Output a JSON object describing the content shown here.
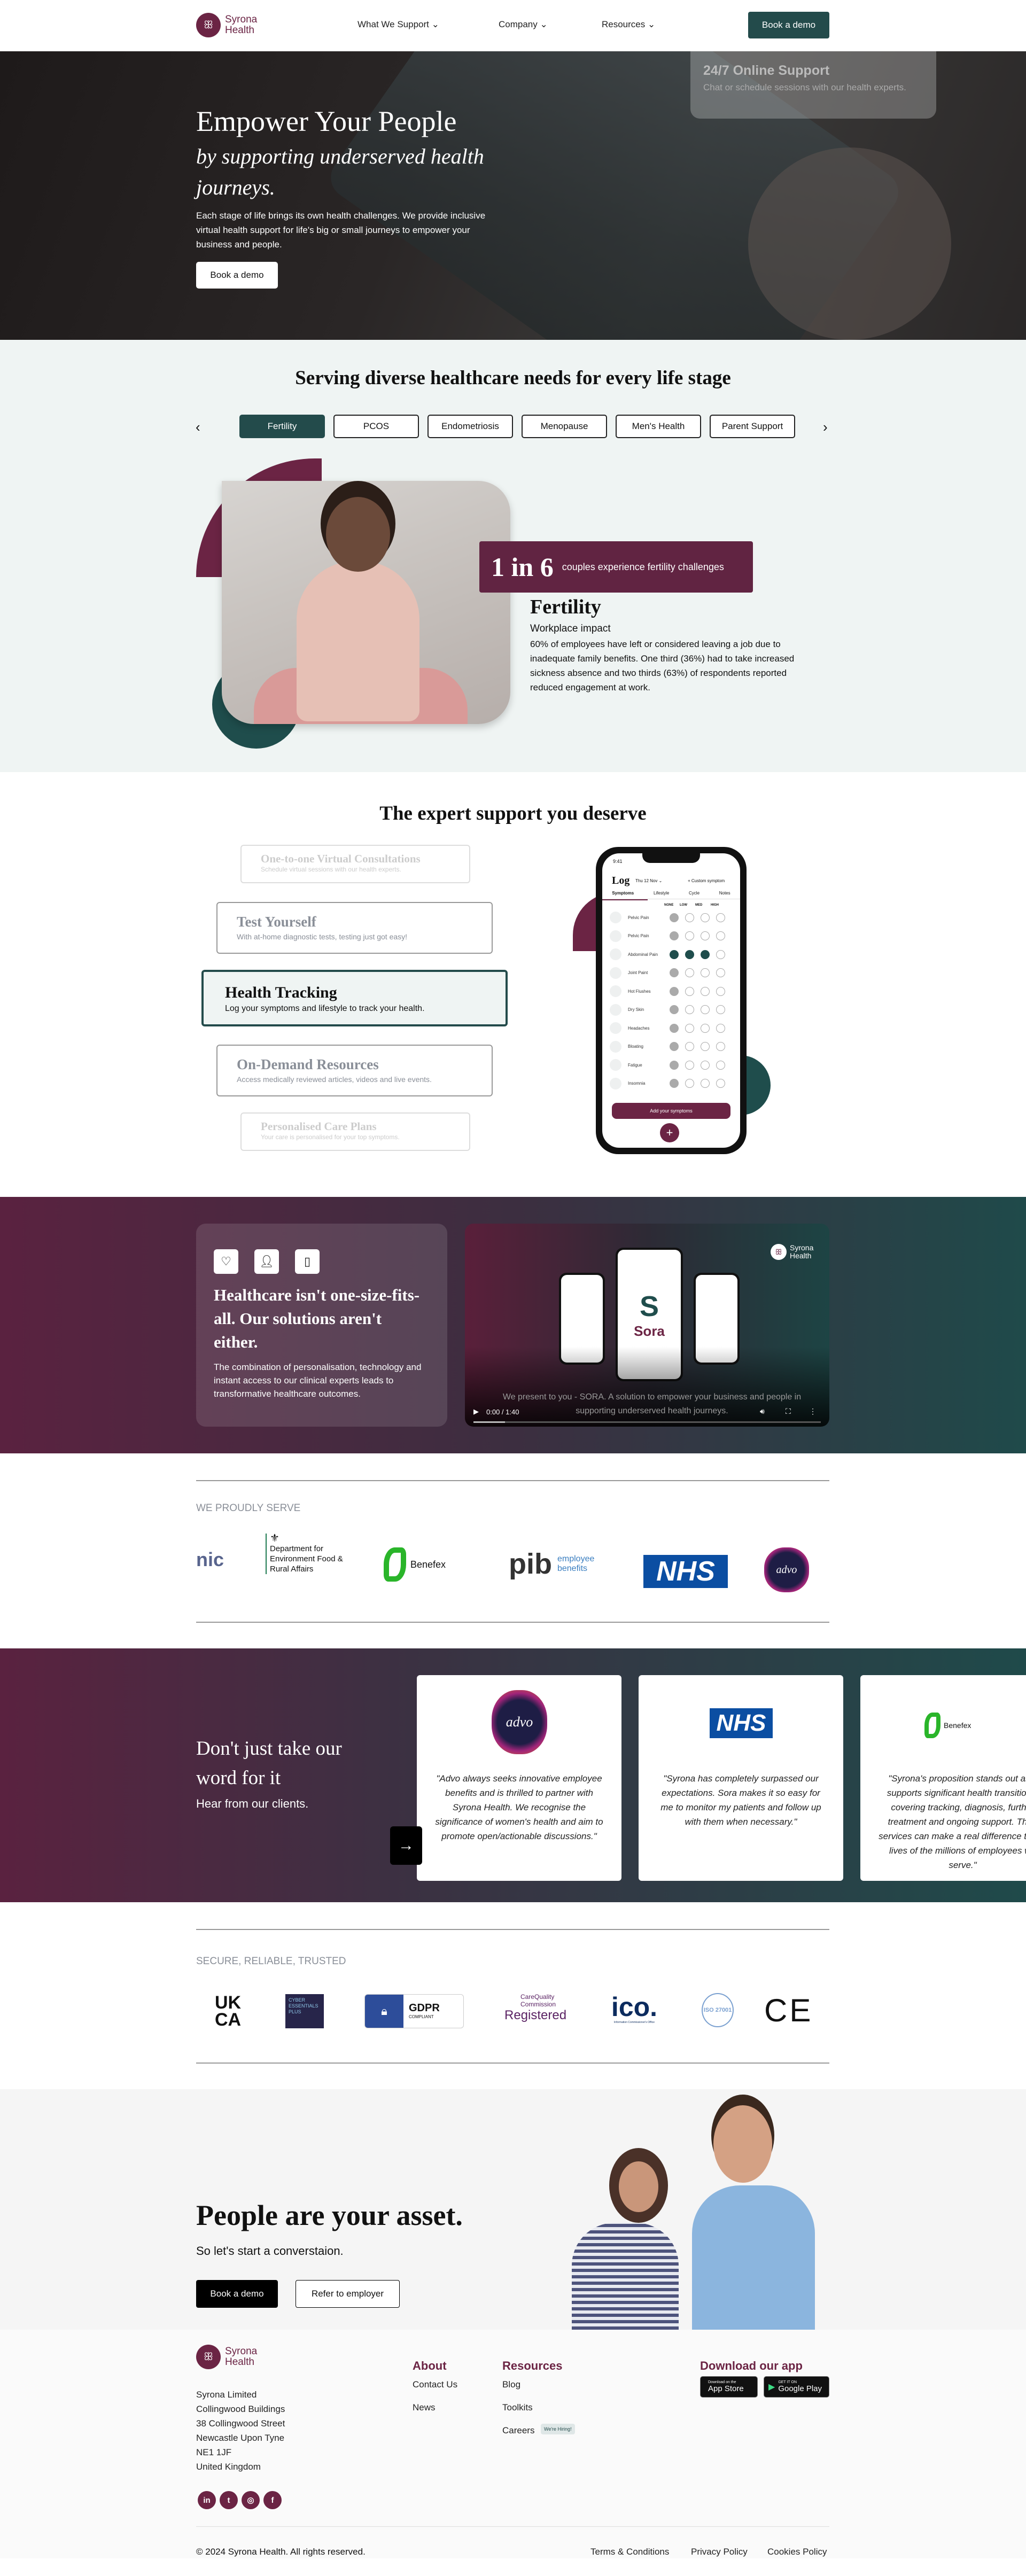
{
  "nav": {
    "brand_line1": "Syrona",
    "brand_line2": "Health",
    "items": [
      {
        "label": "What We Support"
      },
      {
        "label": "Company"
      },
      {
        "label": "Resources"
      }
    ],
    "cta": "Book a demo"
  },
  "hero": {
    "title": "Empower Your People",
    "subtitle": "by supporting underserved health journeys.",
    "body": "Each stage of life brings its own health challenges. We provide inclusive virtual health support for life's big or small journeys to empower your business and people.",
    "cta": "Book a demo",
    "overlay_title": "24/7 Online Support",
    "overlay_text": "Chat or schedule sessions with our health experts."
  },
  "life_stage": {
    "title": "Serving diverse healthcare needs for every life stage",
    "tabs": [
      "Fertility",
      "PCOS",
      "Endometriosis",
      "Menopause",
      "Men's Health",
      "Parent Support"
    ],
    "active_tab": "Fertility",
    "stat_value": "1 in 6",
    "stat_text": "couples experience fertility challenges",
    "heading": "Fertility",
    "subheading": "Workplace impact",
    "body": "60% of employees have left or considered leaving a job due to inadequate family benefits. One third (36%) had to take increased sickness absence and two thirds (63%) of respondents reported reduced engagement at work."
  },
  "expert": {
    "title": "The expert support you deserve",
    "cards": [
      {
        "title": "One-to-one Virtual Consultations",
        "text": "Schedule virtual sessions with our health experts."
      },
      {
        "title": "Test Yourself",
        "text": "With at-home diagnostic tests, testing just got easy!"
      },
      {
        "title": "Health Tracking",
        "text": "Log your symptoms and lifestyle to track your health."
      },
      {
        "title": "On-Demand Resources",
        "text": "Access medically reviewed articles, videos and live events."
      },
      {
        "title": "Personalised Care Plans",
        "text": "Your care is personalised for your top symptoms."
      }
    ],
    "active_card": "Health Tracking",
    "phone": {
      "time": "9:41",
      "title": "Log",
      "date": "Thu 12 Nov",
      "custom": "+ Custom symptom",
      "tabs": [
        "Symptoms",
        "Lifestyle",
        "Cycle",
        "Notes"
      ],
      "levels": [
        "NONE",
        "LOW",
        "MED",
        "HIGH"
      ],
      "symptoms": [
        {
          "name": "Pelvic Pain",
          "level": "NONE"
        },
        {
          "name": "Pelvic Pain",
          "level": "NONE"
        },
        {
          "name": "Abdominal Pain",
          "level": "MED"
        },
        {
          "name": "Joint Paint",
          "level": "NONE"
        },
        {
          "name": "Hot Flushes",
          "level": "NONE"
        },
        {
          "name": "Dry Skin",
          "level": "NONE"
        },
        {
          "name": "Headaches",
          "level": "NONE"
        },
        {
          "name": "Bloating",
          "level": "NONE"
        },
        {
          "name": "Fatigue",
          "level": "NONE"
        },
        {
          "name": "Insomnia",
          "level": "NONE"
        }
      ],
      "add_button": "Add your symptoms"
    }
  },
  "solutions": {
    "icons": [
      "heart-pulse-icon",
      "user-icon",
      "tablet-plus-icon"
    ],
    "heading": "Healthcare isn't one-size-fits-all. Our solutions aren't either.",
    "body": "The combination of personalisation, technology and instant access to our clinical experts leads to transformative healthcare outcomes.",
    "video": {
      "app_name": "Sora",
      "brand_line1": "Syrona",
      "brand_line2": "Health",
      "caption": "We present to you - SORA. A solution to empower your business and people in supporting underserved health journeys.",
      "time": "0:00 / 1:40",
      "progress": 0.09
    }
  },
  "serve": {
    "kicker": "WE PROUDLY SERVE",
    "logos": [
      "nic",
      "Department for Environment Food & Rural Affairs",
      "Benefex",
      "pib",
      "employee benefits",
      "NHS",
      "advo"
    ]
  },
  "testimonials": {
    "heading": "Don't just take our word for it",
    "sub": "Hear from our clients.",
    "items": [
      {
        "logo": "advo",
        "quote": "\"Advo always seeks innovative employee benefits and is thrilled to partner with Syrona Health. We recognise the significance of women's health and aim to promote open/actionable discussions.\""
      },
      {
        "logo": "NHS",
        "quote": "\"Syrona has completely surpassed our expectations. Sora makes it so easy for me to monitor my patients and follow up with them when necessary.\""
      },
      {
        "logo": "Benefex",
        "quote": "\"Syrona's proposition stands out as it supports significant health transitions, covering tracking, diagnosis, further treatment and ongoing support. Their services can make a real difference to the lives of the millions of employees we serve.\""
      }
    ]
  },
  "trust": {
    "kicker": "SECURE, RELIABLE, TRUSTED",
    "logos": [
      "UK CA",
      "CYBER ESSENTIALS PLUS",
      "GDPR",
      "COMPLIANT",
      "CareQuality Commission",
      "Registered",
      "ico.",
      "Information Commissioner's Office",
      "ISO 27001",
      "CE"
    ]
  },
  "cta": {
    "title": "People are your asset.",
    "sub": "So let's start a converstaion.",
    "primary": "Book a demo",
    "secondary": "Refer to employer"
  },
  "footer": {
    "brand_line1": "Syrona",
    "brand_line2": "Health",
    "address": [
      "Syrona Limited",
      "Collingwood Buildings",
      "38 Collingwood Street",
      "Newcastle Upon Tyne",
      "NE1 1JF",
      "United Kingdom"
    ],
    "about_title": "About",
    "about_links": [
      "Contact Us",
      "News"
    ],
    "resources_title": "Resources",
    "resources_links": [
      "Blog",
      "Toolkits",
      "Careers"
    ],
    "hiring_badge": "We're Hiring!",
    "app_title": "Download our app",
    "app_store_small": "Download on the",
    "app_store": "App Store",
    "play_small": "GET IT ON",
    "play": "Google Play",
    "socials": [
      "linkedin-icon",
      "twitter-icon",
      "instagram-icon",
      "facebook-icon"
    ],
    "copyright": "© 2024 Syrona Health. All rights reserved.",
    "legal": [
      "Terms & Conditions",
      "Privacy Policy",
      "Cookies Policy"
    ]
  },
  "colors": {
    "maroon": "#6b2444",
    "teal": "#234b4b",
    "light_bg": "#eff4f3"
  }
}
